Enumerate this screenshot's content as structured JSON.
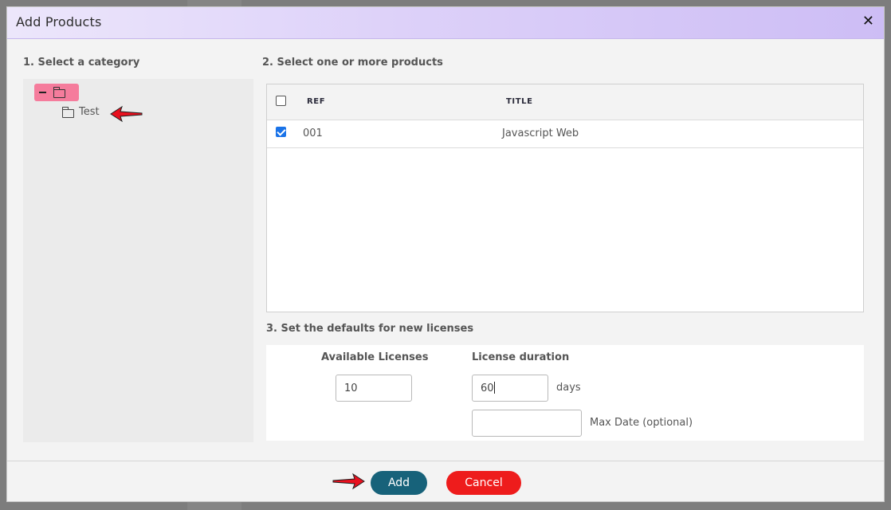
{
  "dialog": {
    "title": "Add Products",
    "close_glyph": "✕"
  },
  "category": {
    "section_label": "1. Select a category",
    "root_node": {
      "expand_state_icon": "minus-icon",
      "icon": "folder-icon",
      "selected": true
    },
    "children": [
      {
        "label": "Test",
        "icon": "folder-icon"
      }
    ]
  },
  "products": {
    "section_label": "2. Select one or more products",
    "columns": [
      "REF",
      "TITLE"
    ],
    "select_all_checked": false,
    "rows": [
      {
        "ref": "001",
        "title": "Javascript Web",
        "checked": true
      }
    ]
  },
  "defaults": {
    "section_label": "3. Set the defaults for new licenses",
    "available_licenses_label": "Available Licenses",
    "available_licenses_value": "10",
    "license_duration_label": "License duration",
    "license_duration_value": "60",
    "duration_unit": "days",
    "max_date_value": "",
    "max_date_label": "Max Date (optional)"
  },
  "footer": {
    "add_label": "Add",
    "cancel_label": "Cancel"
  },
  "colors": {
    "header_gradient_start": "#ece6fb",
    "header_gradient_end": "#cdbdf5",
    "selected_node": "#f57c9c",
    "checkbox_checked": "#1a73e8",
    "add_button": "#17627a",
    "cancel_button": "#ee1c1c",
    "annotation_arrow": "#e8101e"
  }
}
